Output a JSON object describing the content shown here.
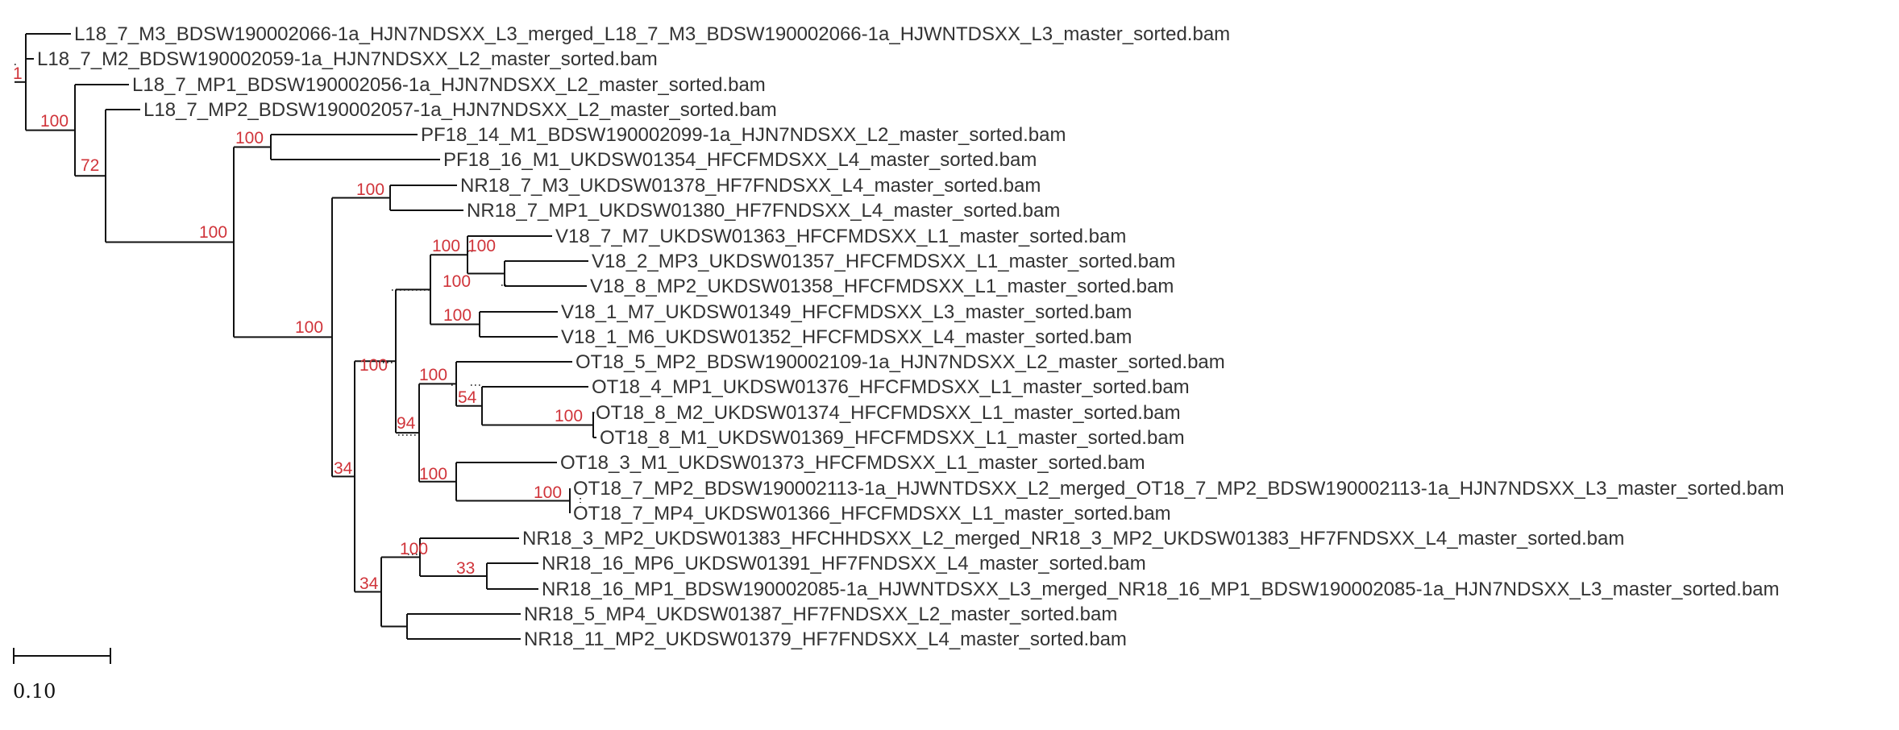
{
  "scale_bar": {
    "label": "0.10"
  },
  "support_color": "#d0343a",
  "leaves": [
    "L18_7_M3_BDSW190002066-1a_HJN7NDSXX_L3_merged_L18_7_M3_BDSW190002066-1a_HJWNTDSXX_L3_master_sorted.bam",
    "L18_7_M2_BDSW190002059-1a_HJN7NDSXX_L2_master_sorted.bam",
    "L18_7_MP1_BDSW190002056-1a_HJN7NDSXX_L2_master_sorted.bam",
    "L18_7_MP2_BDSW190002057-1a_HJN7NDSXX_L2_master_sorted.bam",
    "PF18_14_M1_BDSW190002099-1a_HJN7NDSXX_L2_master_sorted.bam",
    "PF18_16_M1_UKDSW01354_HFCFMDSXX_L4_master_sorted.bam",
    "NR18_7_M3_UKDSW01378_HF7FNDSXX_L4_master_sorted.bam",
    "NR18_7_MP1_UKDSW01380_HF7FNDSXX_L4_master_sorted.bam",
    "V18_7_M7_UKDSW01363_HFCFMDSXX_L1_master_sorted.bam",
    "V18_2_MP3_UKDSW01357_HFCFMDSXX_L1_master_sorted.bam",
    "V18_8_MP2_UKDSW01358_HFCFMDSXX_L1_master_sorted.bam",
    "V18_1_M7_UKDSW01349_HFCFMDSXX_L3_master_sorted.bam",
    "V18_1_M6_UKDSW01352_HFCFMDSXX_L4_master_sorted.bam",
    "OT18_5_MP2_BDSW190002109-1a_HJN7NDSXX_L2_master_sorted.bam",
    "OT18_4_MP1_UKDSW01376_HFCFMDSXX_L1_master_sorted.bam",
    "OT18_8_M2_UKDSW01374_HFCFMDSXX_L1_master_sorted.bam",
    "OT18_8_M1_UKDSW01369_HFCFMDSXX_L1_master_sorted.bam",
    "OT18_3_M1_UKDSW01373_HFCFMDSXX_L1_master_sorted.bam",
    "OT18_7_MP2_BDSW190002113-1a_HJWNTDSXX_L2_merged_OT18_7_MP2_BDSW190002113-1a_HJN7NDSXX_L3_master_sorted.bam",
    "OT18_7_MP4_UKDSW01366_HFCFMDSXX_L1_master_sorted.bam",
    "NR18_3_MP2_UKDSW01383_HFCHHDSXX_L2_merged_NR18_3_MP2_UKDSW01383_HF7FNDSXX_L4_master_sorted.bam",
    "NR18_16_MP6_UKDSW01391_HF7FNDSXX_L4_master_sorted.bam",
    "NR18_16_MP1_BDSW190002085-1a_HJWNTDSXX_L3_merged_NR18_16_MP1_BDSW190002085-1a_HJN7NDSXX_L3_master_sorted.bam",
    "NR18_5_MP4_UKDSW01387_HF7FNDSXX_L2_master_sorted.bam",
    "NR18_11_MP2_UKDSW01379_HF7FNDSXX_L4_master_sorted.bam"
  ],
  "support_values": [
    "1",
    "100",
    "72",
    "100",
    "100",
    "100",
    "100",
    "100",
    "100",
    "100",
    "100",
    "100",
    "54",
    "100",
    "94",
    "100",
    "100",
    "34",
    "100",
    "100",
    "34",
    "33"
  ]
}
